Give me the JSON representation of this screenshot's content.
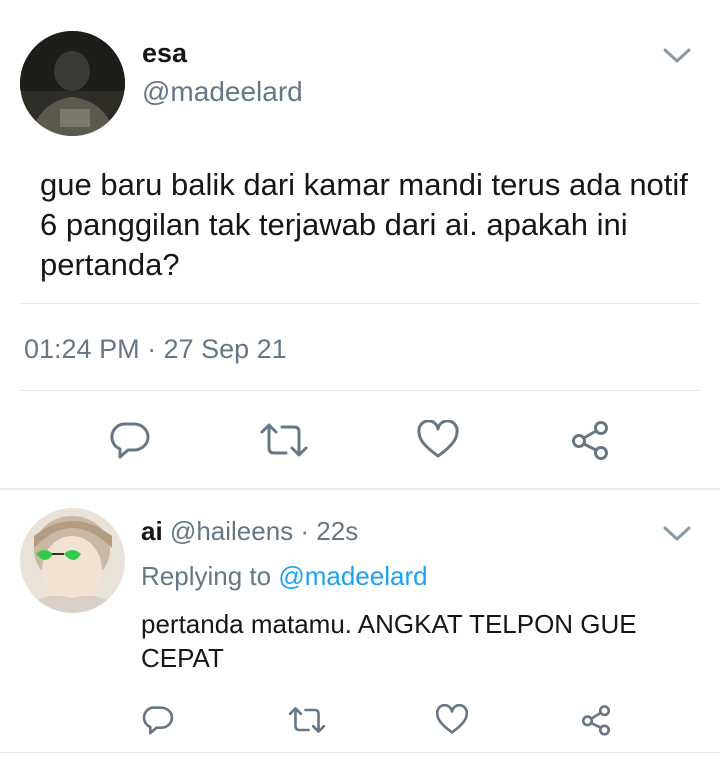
{
  "tweet": {
    "author_name": "esa",
    "author_handle": "@madeelard",
    "text": "gue baru balik dari kamar mandi terus ada notif 6 panggilan tak terjawab dari ai. apakah ini pertanda?",
    "timestamp": "01:24 PM · 27 Sep 21",
    "actions": [
      "reply-icon",
      "retweet-icon",
      "like-icon",
      "share-icon"
    ]
  },
  "reply": {
    "author_name": "ai",
    "author_handle": "@haileens",
    "time_ago": "· 22s",
    "replying_to_label": "Replying to",
    "replying_to_handle": "@madeelard",
    "text": "pertanda matamu. ANGKAT TELPON GUE CEPAT",
    "actions": [
      "reply-icon",
      "retweet-icon",
      "like-icon",
      "share-icon"
    ]
  },
  "colors": {
    "text": "#14171a",
    "muted": "#657786",
    "link": "#1da1f2",
    "divider": "#e1e8ed"
  }
}
